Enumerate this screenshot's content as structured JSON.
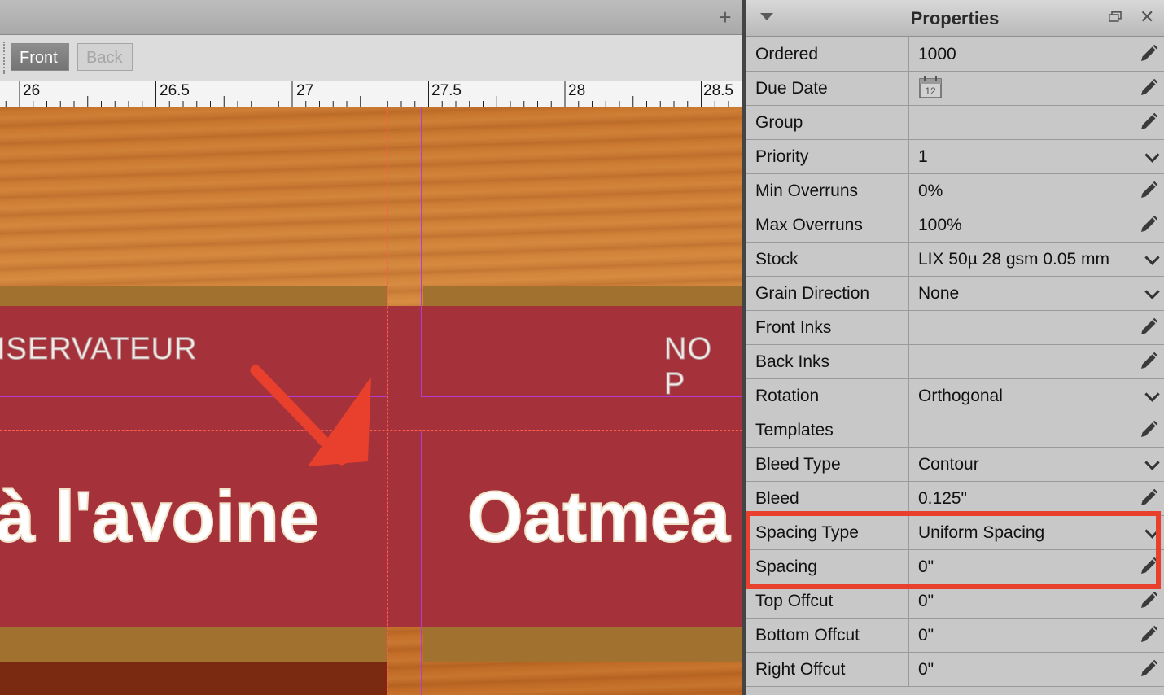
{
  "toolbar": {
    "front_label": "Front",
    "back_label": "Back",
    "add_tab_glyph": "+"
  },
  "ruler": {
    "labels": [
      "26",
      "26.5",
      "27",
      "27.5",
      "28",
      "28.5"
    ]
  },
  "artwork": {
    "left_small_text": "ISERVATEUR",
    "right_small_text": "NO P",
    "left_title": "à l'avoine",
    "right_title": "Oatmea"
  },
  "annotations": {
    "arrow_color": "#e8402c",
    "highlight_color": "#e8402c"
  },
  "properties": {
    "title": "Properties",
    "rows": [
      {
        "label": "Ordered",
        "value": "1000",
        "control": "pencil"
      },
      {
        "label": "Due Date",
        "value": "",
        "control": "pencil",
        "icon": "calendar-icon",
        "icon_text": "12"
      },
      {
        "label": "Group",
        "value": "",
        "control": "pencil"
      },
      {
        "label": "Priority",
        "value": "1",
        "control": "dropdown"
      },
      {
        "label": "Min Overruns",
        "value": "0%",
        "control": "pencil"
      },
      {
        "label": "Max Overruns",
        "value": "100%",
        "control": "pencil"
      },
      {
        "label": "Stock",
        "value": "LIX 50µ 28 gsm 0.05 mm",
        "control": "dropdown"
      },
      {
        "label": "Grain Direction",
        "value": "None",
        "control": "dropdown"
      },
      {
        "label": "Front Inks",
        "value": "",
        "control": "pencil"
      },
      {
        "label": "Back Inks",
        "value": "",
        "control": "pencil"
      },
      {
        "label": "Rotation",
        "value": "Orthogonal",
        "control": "dropdown"
      },
      {
        "label": "Templates",
        "value": "",
        "control": "pencil"
      },
      {
        "label": "Bleed Type",
        "value": "Contour",
        "control": "dropdown"
      },
      {
        "label": "Bleed",
        "value": "0.125\"",
        "control": "pencil"
      },
      {
        "label": "Spacing Type",
        "value": "Uniform Spacing",
        "control": "dropdown"
      },
      {
        "label": "Spacing",
        "value": "0\"",
        "control": "pencil"
      },
      {
        "label": "Top Offcut",
        "value": "0\"",
        "control": "pencil"
      },
      {
        "label": "Bottom Offcut",
        "value": "0\"",
        "control": "pencil"
      },
      {
        "label": "Right Offcut",
        "value": "0\"",
        "control": "pencil"
      }
    ]
  }
}
